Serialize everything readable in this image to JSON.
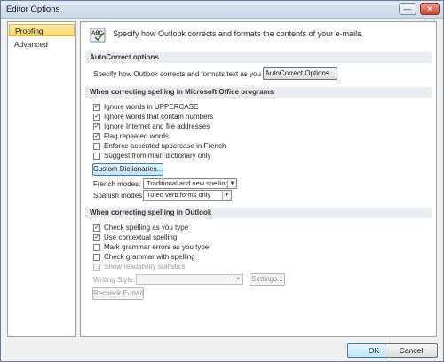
{
  "window": {
    "title": "Editor Options",
    "minimize_label": "—",
    "close_label": "✕"
  },
  "sidebar": {
    "items": [
      {
        "label": "Proofing",
        "active": true
      },
      {
        "label": "Advanced",
        "active": false
      }
    ]
  },
  "header": {
    "icon": "abc-spelling-icon",
    "text": "Specify how Outlook corrects and formats the contents of your e-mails."
  },
  "autocorrect": {
    "heading": "AutoCorrect options",
    "description": "Specify how Outlook corrects and formats text as you type.",
    "button_label": "AutoCorrect Options..."
  },
  "office_spelling": {
    "heading": "When correcting spelling in Microsoft Office programs",
    "options": [
      {
        "label": "Ignore words in UPPERCASE",
        "checked": true
      },
      {
        "label": "Ignore words that contain numbers",
        "checked": true
      },
      {
        "label": "Ignore Internet and file addresses",
        "checked": true
      },
      {
        "label": "Flag repeated words",
        "checked": true
      },
      {
        "label": "Enforce accented uppercase in French",
        "checked": false
      },
      {
        "label": "Suggest from main dictionary only",
        "checked": false
      }
    ],
    "custom_dictionaries_label": "Custom Dictionaries...",
    "french_modes_label": "French modes:",
    "french_modes_value": "Traditional and new spellings",
    "spanish_modes_label": "Spanish modes:",
    "spanish_modes_value": "Tuteo verb forms only"
  },
  "outlook_spelling": {
    "heading": "When correcting spelling in Outlook",
    "options": [
      {
        "label": "Check spelling as you type",
        "checked": true,
        "disabled": false
      },
      {
        "label": "Use contextual spelling",
        "checked": true,
        "disabled": false
      },
      {
        "label": "Mark grammar errors as you type",
        "checked": false,
        "disabled": false
      },
      {
        "label": "Check grammar with spelling",
        "checked": false,
        "disabled": false
      },
      {
        "label": "Show readability statistics",
        "checked": false,
        "disabled": true
      }
    ],
    "writing_style_label": "Writing Style:",
    "writing_style_value": "",
    "settings_label": "Settings...",
    "recheck_label": "Recheck E-mail"
  },
  "footer": {
    "ok_label": "OK",
    "cancel_label": "Cancel"
  },
  "colors": {
    "active_item": "#fbd86a",
    "section_header_bg": "#e9ecf0",
    "focus_button": "#bee6fd"
  }
}
